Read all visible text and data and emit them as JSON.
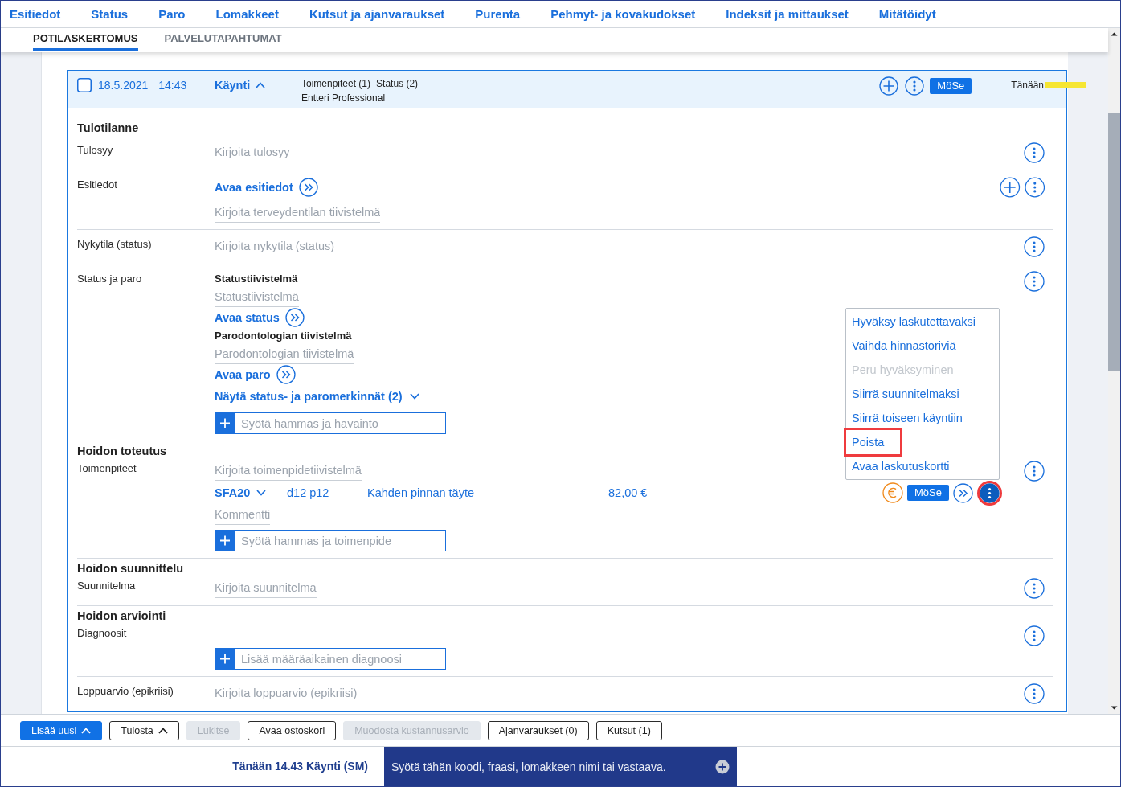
{
  "nav": [
    "Esitiedot",
    "Status",
    "Paro",
    "Lomakkeet",
    "Kutsut ja ajanvaraukset",
    "Purenta",
    "Pehmyt- ja kovakudokset",
    "Indeksit ja mittaukset",
    "Mitätöidyt"
  ],
  "tabs": [
    {
      "label": "POTILASKERTOMUS",
      "selected": true
    },
    {
      "label": "PALVELUTAPAHTUMAT",
      "selected": false
    }
  ],
  "visit": {
    "checked": false,
    "date": "18.5.2021",
    "time": "14:43",
    "type": "Käynti",
    "expanded": true,
    "counts": [
      "Toimenpiteet (1)",
      "Status (2)"
    ],
    "provider": "Entteri Professional",
    "actions": [
      {
        "kind": "add"
      },
      {
        "kind": "menu"
      }
    ],
    "badge": "MöSe",
    "day": "Tänään",
    "sections": [
      {
        "title": "Tulotilanne",
        "rows": [
          {
            "label": "Tulosyy",
            "content": [
              {
                "kind": "field",
                "placeholder": "Kirjoita tulosyy"
              }
            ],
            "actions": [
              {
                "kind": "menu"
              }
            ]
          },
          {
            "label": "Esitiedot",
            "content": [
              {
                "kind": "link",
                "text": "Avaa esitiedot"
              },
              {
                "kind": "field",
                "placeholder": "Kirjoita terveydentilan tiivistelmä"
              }
            ],
            "actions": [
              {
                "kind": "add"
              },
              {
                "kind": "menu"
              }
            ]
          },
          {
            "label": "Nykytila (status)",
            "content": [
              {
                "kind": "field",
                "placeholder": "Kirjoita nykytila (status)"
              }
            ],
            "actions": [
              {
                "kind": "menu"
              }
            ]
          },
          {
            "label": "Status ja paro",
            "content": [
              {
                "kind": "heading",
                "text": "Statustiivistelmä"
              },
              {
                "kind": "field",
                "placeholder": "Statustiivistelmä"
              },
              {
                "kind": "link",
                "text": "Avaa status"
              },
              {
                "kind": "heading",
                "text": "Parodontologian tiivistelmä"
              },
              {
                "kind": "field",
                "placeholder": "Parodontologian tiivistelmä"
              },
              {
                "kind": "link",
                "text": "Avaa paro"
              },
              {
                "kind": "toggle",
                "text": "Näytä status- ja paromerkinnät (2)",
                "expanded": false
              },
              {
                "kind": "entry",
                "placeholder": "Syötä hammas ja havainto"
              }
            ],
            "actions": [
              {
                "kind": "menu"
              }
            ]
          }
        ]
      },
      {
        "title": "Hoidon toteutus",
        "rows": [
          {
            "label": "Toimenpiteet",
            "content": [
              {
                "kind": "field",
                "placeholder": "Kirjoita toimenpidetiivistelmä"
              },
              {
                "kind": "procedure",
                "code": "SFA20",
                "expanded": false,
                "teeth": "d12 p12",
                "name": "Kahden pinnan täyte",
                "price": "82,00 €",
                "badge": "MöSe",
                "menu": {
                  "open": true,
                  "annotated": true,
                  "items": [
                    {
                      "label": "Hyväksy laskutettavaksi",
                      "disabled": false,
                      "annotated": false
                    },
                    {
                      "label": "Vaihda hinnastoriviä",
                      "disabled": false,
                      "annotated": false
                    },
                    {
                      "label": "Peru hyväksyminen",
                      "disabled": true,
                      "annotated": false
                    },
                    {
                      "label": "Siirrä suunnitelmaksi",
                      "disabled": false,
                      "annotated": false
                    },
                    {
                      "label": "Siirrä toiseen käyntiin",
                      "disabled": false,
                      "annotated": false
                    },
                    {
                      "label": "Poista",
                      "disabled": false,
                      "annotated": true
                    },
                    {
                      "label": "Avaa laskutuskortti",
                      "disabled": false,
                      "annotated": false
                    }
                  ]
                }
              },
              {
                "kind": "field",
                "placeholder": "Kommentti"
              },
              {
                "kind": "entry",
                "placeholder": "Syötä hammas ja toimenpide"
              }
            ],
            "actions": [
              {
                "kind": "menu"
              }
            ]
          }
        ]
      },
      {
        "title": "Hoidon suunnittelu",
        "rows": [
          {
            "label": "Suunnitelma",
            "content": [
              {
                "kind": "field",
                "placeholder": "Kirjoita suunnitelma"
              }
            ],
            "actions": [
              {
                "kind": "menu"
              }
            ]
          }
        ]
      },
      {
        "title": "Hoidon arviointi",
        "rows": [
          {
            "label": "Diagnoosit",
            "content": [
              {
                "kind": "entry",
                "placeholder": "Lisää määräaikainen diagnoosi"
              }
            ],
            "actions": [
              {
                "kind": "menu"
              }
            ]
          },
          {
            "label": "Loppuarvio (epikriisi)",
            "content": [
              {
                "kind": "field",
                "placeholder": "Kirjoita loppuarvio (epikriisi)"
              }
            ],
            "actions": [
              {
                "kind": "menu"
              }
            ]
          }
        ]
      }
    ]
  },
  "toolbar": [
    {
      "label": "Lisää uusi",
      "kind": "primary",
      "disabled": false,
      "dropdown": true
    },
    {
      "label": "Tulosta",
      "kind": "outline",
      "disabled": false,
      "dropdown": true
    },
    {
      "label": "Lukitse",
      "kind": "outline",
      "disabled": true,
      "dropdown": false
    },
    {
      "label": "Avaa ostoskori",
      "kind": "outline",
      "disabled": false,
      "dropdown": false
    },
    {
      "label": "Muodosta kustannusarvio",
      "kind": "outline",
      "disabled": true,
      "dropdown": false
    },
    {
      "label": "Ajanvaraukset (0)",
      "kind": "outline",
      "disabled": false,
      "dropdown": false
    },
    {
      "label": "Kutsut (1)",
      "kind": "outline",
      "disabled": false,
      "dropdown": false
    }
  ],
  "status_bar": {
    "current": "Tänään 14.43 Käynti (SM)",
    "command_placeholder": "Syötä tähän koodi, fraasi, lomakkeen nimi tai vastaava."
  }
}
